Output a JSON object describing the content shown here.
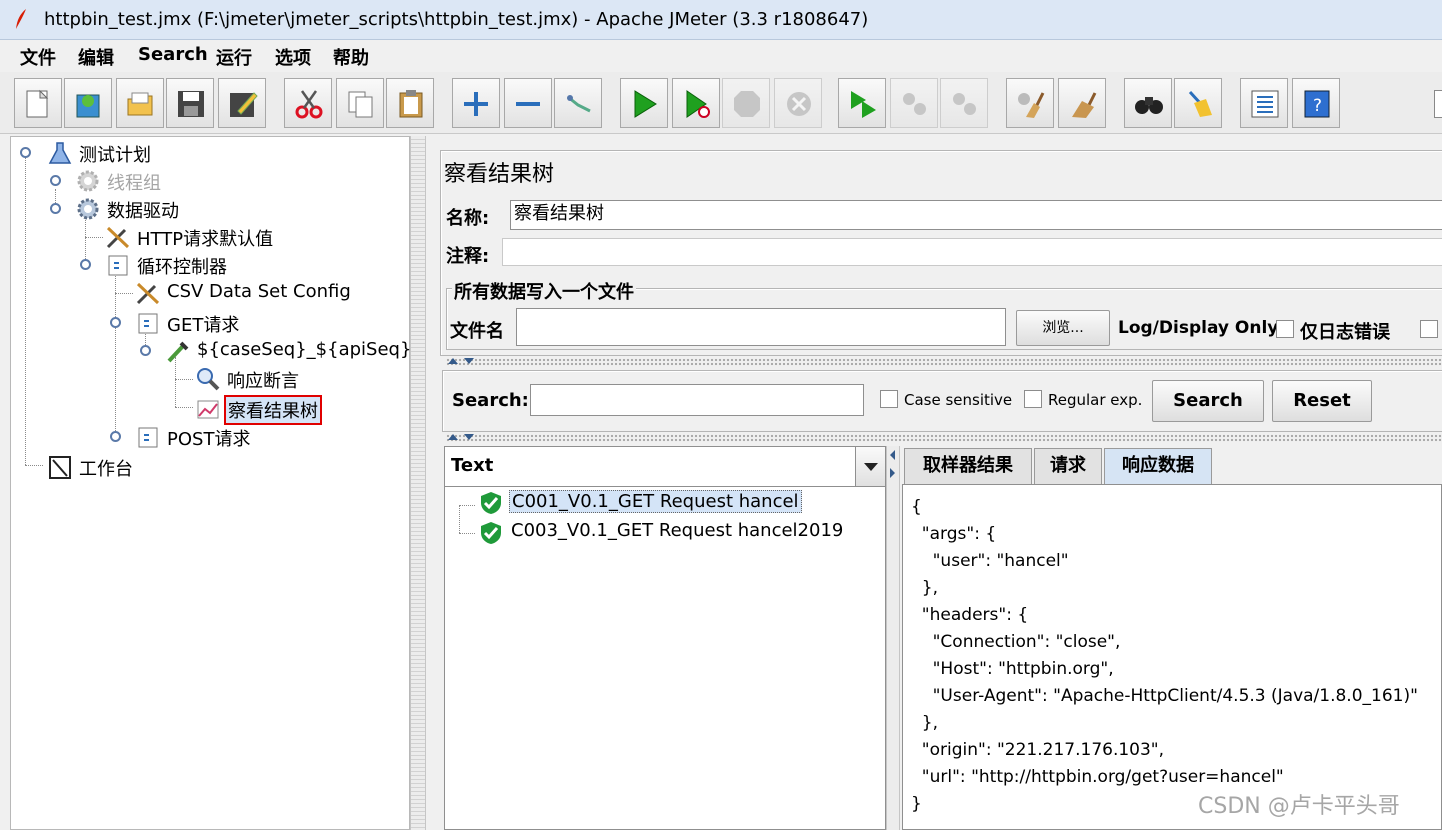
{
  "window": {
    "title": "httpbin_test.jmx (F:\\jmeter\\jmeter_scripts\\httpbin_test.jmx) - Apache JMeter (3.3 r1808647)"
  },
  "menu": [
    "文件",
    "编辑",
    "Search",
    "运行",
    "选项",
    "帮助"
  ],
  "tree": [
    {
      "label": "测试计划",
      "icon": "test-plan-icon"
    },
    {
      "label": "线程组",
      "icon": "gear-icon",
      "disabled": true
    },
    {
      "label": "数据驱动",
      "icon": "gear-icon"
    },
    {
      "label": "HTTP请求默认值",
      "icon": "wrench-icon"
    },
    {
      "label": "循环控制器",
      "icon": "controller-icon"
    },
    {
      "label": "CSV Data Set Config",
      "icon": "wrench-icon"
    },
    {
      "label": "GET请求",
      "icon": "controller-icon"
    },
    {
      "label": "${caseSeq}_${apiSeq}_$",
      "icon": "pipette-icon"
    },
    {
      "label": "响应断言",
      "icon": "magnifier-icon"
    },
    {
      "label": "察看结果树",
      "icon": "chart-icon",
      "selected": true
    },
    {
      "label": "POST请求",
      "icon": "controller-icon"
    },
    {
      "label": "工作台",
      "icon": "workbench-icon"
    }
  ],
  "panel": {
    "title": "察看结果树",
    "name_label": "名称:",
    "name_value": "察看结果树",
    "comment_label": "注释:",
    "comment_value": "",
    "file_section_title": "所有数据写入一个文件",
    "filename_label": "文件名",
    "filename_value": "",
    "browse_label": "浏览...",
    "log_display_label": "Log/Display Only:",
    "errors_only_label": "仅日志错误"
  },
  "search": {
    "label": "Search:",
    "value": "",
    "case_sensitive_label": "Case sensitive",
    "regex_label": "Regular exp.",
    "search_button": "Search",
    "reset_button": "Reset"
  },
  "results": {
    "combo_value": "Text",
    "items": [
      {
        "label": "C001_V0.1_GET Request hancel",
        "status": "success",
        "selected": true
      },
      {
        "label": "C003_V0.1_GET Request hancel2019",
        "status": "success"
      }
    ]
  },
  "tabs": [
    "取样器结果",
    "请求",
    "响应数据"
  ],
  "active_tab": "响应数据",
  "response_lines": [
    "{",
    "  \"args\": {",
    "    \"user\": \"hancel\"",
    "  },",
    "  \"headers\": {",
    "    \"Connection\": \"close\",",
    "    \"Host\": \"httpbin.org\",",
    "    \"User-Agent\": \"Apache-HttpClient/4.5.3 (Java/1.8.0_161)\"",
    "  },",
    "  \"origin\": \"221.217.176.103\",",
    "  \"url\": \"http://httpbin.org/get?user=hancel\"",
    "}"
  ],
  "watermark": "CSDN @卢卡平头哥"
}
